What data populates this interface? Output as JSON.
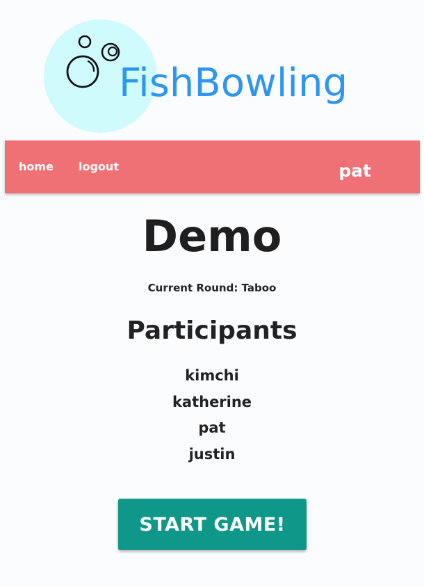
{
  "logo": {
    "text": "FishBowling",
    "icon": "bubbles-icon",
    "circle_color": "#cffbfd",
    "text_color": "#2e96ee"
  },
  "nav": {
    "home_label": "home",
    "logout_label": "logout",
    "username": "pat",
    "background_color": "#ef7175"
  },
  "game": {
    "title": "Demo",
    "current_round": "Current Round: Taboo"
  },
  "participants": {
    "heading": "Participants",
    "names": [
      "kimchi",
      "katherine",
      "pat",
      "justin"
    ]
  },
  "start_button": {
    "label": "START GAME!",
    "color": "#0f9889"
  }
}
